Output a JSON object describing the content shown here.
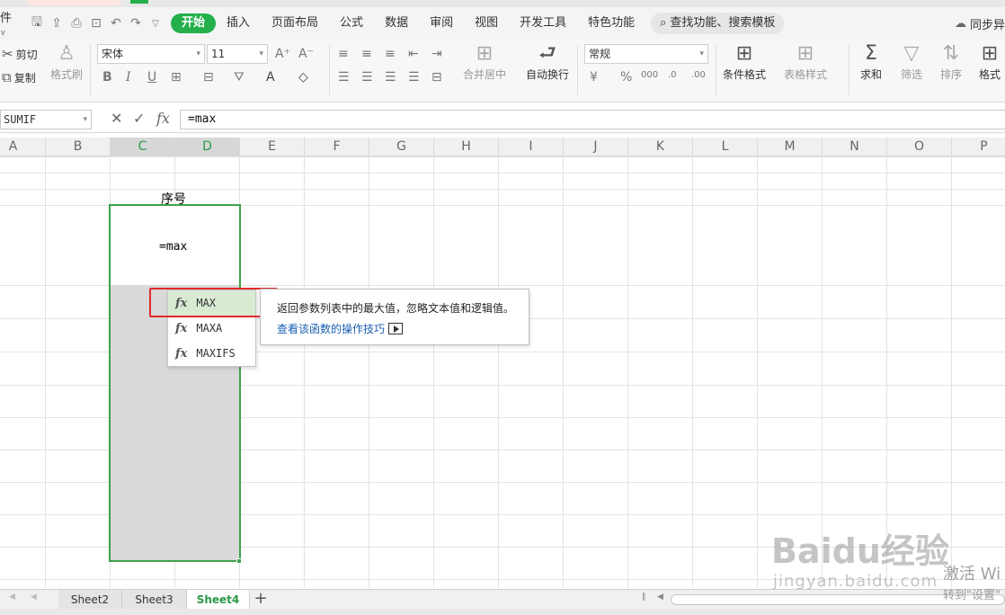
{
  "menubar": {
    "file_label": "件",
    "tabs": [
      "开始",
      "插入",
      "页面布局",
      "公式",
      "数据",
      "审阅",
      "视图",
      "开发工具",
      "特色功能"
    ],
    "active_tab": "开始",
    "search_label": "查找功能、搜索模板",
    "sync_label": "同步异"
  },
  "ribbon": {
    "cut": "剪切",
    "copy": "复制",
    "format_painter": "格式刷",
    "font_name": "宋体",
    "font_size": "11",
    "merge_center": "合并居中",
    "wrap_text": "自动换行",
    "number_format": "常规",
    "conditional_format": "条件格式",
    "table_style": "表格样式",
    "sum": "求和",
    "filter": "筛选",
    "sort": "排序",
    "format": "格式"
  },
  "formula_bar": {
    "name_box": "SUMIF",
    "cancel_glyph": "✕",
    "confirm_glyph": "✓",
    "fx_glyph": "fx",
    "formula": "=max"
  },
  "columns": [
    "A",
    "B",
    "C",
    "D",
    "E",
    "F",
    "G",
    "H",
    "I",
    "J",
    "K",
    "L",
    "M",
    "N",
    "O",
    "P"
  ],
  "cells": {
    "header_label": "序号",
    "editing_value": "=max"
  },
  "autocomplete": {
    "items": [
      {
        "fx": "fx",
        "name": "MAX"
      },
      {
        "fx": "fx",
        "name": "MAXA"
      },
      {
        "fx": "fx",
        "name": "MAXIFS"
      }
    ],
    "selected": "MAX",
    "description": "返回参数列表中的最大值，忽略文本值和逻辑值。",
    "help_link": "查看该函数的操作技巧"
  },
  "sheets": {
    "tabs": [
      "Sheet2",
      "Sheet3",
      "Sheet4"
    ],
    "active": "Sheet4",
    "add_glyph": "+"
  },
  "watermark": {
    "activate_line1": "激活 Wi",
    "activate_line2": "转到\"设置\"",
    "baidu_brand": "Baidu经验",
    "baidu_url": "jingyan.baidu.com"
  },
  "colors": {
    "accent_green": "#23b04b",
    "selection_green": "#3fa14e",
    "highlight_red": "#e02b2b",
    "link_blue": "#1a5fb4"
  }
}
